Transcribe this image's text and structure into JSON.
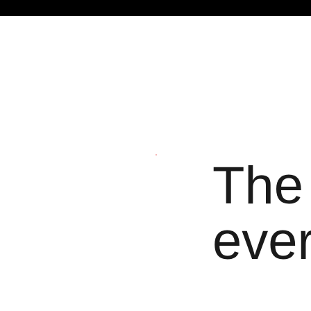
{
  "header": {
    "bar_color": "#000000"
  },
  "content": {
    "line_1": "The",
    "line_2": "ever",
    "text_color": "#1a1a1a"
  }
}
